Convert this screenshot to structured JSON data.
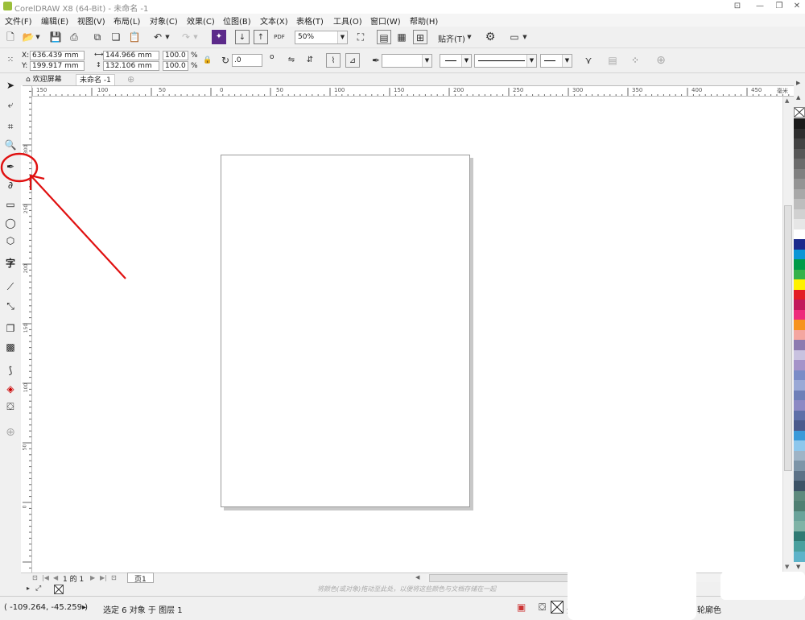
{
  "window": {
    "title": "CorelDRAW X8 (64-Bit) - 未命名 -1",
    "controls": [
      "⊡",
      "—",
      "❐",
      "✕"
    ]
  },
  "menu": [
    "文件(F)",
    "编辑(E)",
    "视图(V)",
    "布局(L)",
    "对象(C)",
    "效果(C)",
    "位图(B)",
    "文本(X)",
    "表格(T)",
    "工具(O)",
    "窗口(W)",
    "帮助(H)"
  ],
  "toolbar": {
    "zoom": "50%",
    "snap_label": "贴齐(T)",
    "pdf_label": "PDF"
  },
  "propbar": {
    "x_label": "X:",
    "x_value": "636.439 mm",
    "y_label": "Y:",
    "y_value": "199.917 mm",
    "width_value": "144.966 mm",
    "height_value": "132.106 mm",
    "scale_x": "100.0",
    "scale_y": "100.0",
    "percent": "%",
    "rotation": ".0",
    "degree": "o"
  },
  "tabs": {
    "welcome": "欢迎屏幕",
    "doc": "未命名 -1"
  },
  "ruler": {
    "h_labels": [
      "150",
      "100",
      "50",
      "0",
      "50",
      "100",
      "150",
      "200",
      "250",
      "300",
      "350",
      "400",
      "450"
    ],
    "h_unit": "毫米",
    "v_labels": [
      "300",
      "250",
      "200",
      "150",
      "100",
      "50",
      "0"
    ]
  },
  "pagenav": {
    "page_of": "1 的 1",
    "page_tab": "页1"
  },
  "colorbar": {
    "hint": "将颜色(或对象)拖动至此处，以便将这些颜色与文档存储在一起"
  },
  "status": {
    "coords": "( -109.264, -45.259 )",
    "arrow": "▸",
    "selection": "选定 6 对象 于 图层 1",
    "fill_none": "无",
    "outline_label": "轮廓色"
  },
  "colors": {
    "annotation": "#e01010",
    "palette": [
      "#1a1a1a",
      "#2e2e2e",
      "#424242",
      "#575757",
      "#6b6b6b",
      "#808080",
      "#949494",
      "#a8a8a8",
      "#bdbdbd",
      "#d1d1d1",
      "#e6e6e6",
      "#ffffff",
      "#1b2a8c",
      "#0a96d6",
      "#009b48",
      "#36b24a",
      "#fff200",
      "#e31e24",
      "#c2185b",
      "#ee2a7b",
      "#f7931e",
      "#f4a6a0",
      "#8d7bb0",
      "#c9c2e0",
      "#a593c9",
      "#7a8cc7",
      "#9aa9d6",
      "#6e7fb8",
      "#8c89c4",
      "#5e6fa8",
      "#4a5a8c",
      "#3a9ad9",
      "#8ec7ec",
      "#9fb4c6",
      "#7d95a8",
      "#5c7287",
      "#3d5366",
      "#5e8a7d",
      "#4f7f72",
      "#6aa39a",
      "#7fb3a6",
      "#2f7a73",
      "#49a09e",
      "#5db3c9"
    ]
  }
}
